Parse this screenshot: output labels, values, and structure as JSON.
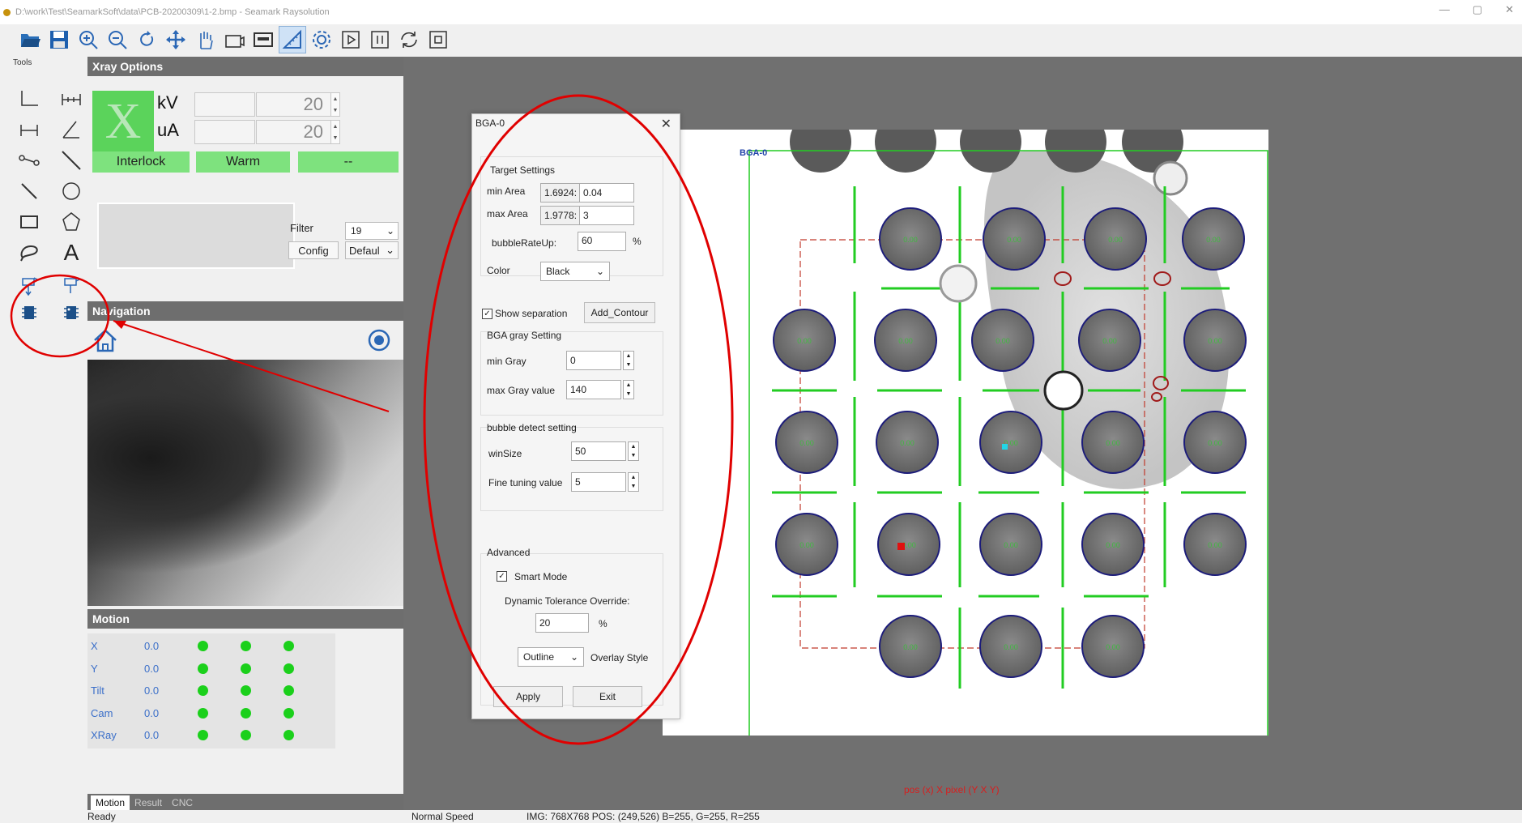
{
  "window": {
    "title": "D:\\work\\Test\\SeamarkSoft\\data\\PCB-20200309\\1-2.bmp - Seamark Raysolution",
    "controls": [
      "—",
      "▢",
      "✕"
    ]
  },
  "toolbar": {
    "icons": [
      "folder-open-icon",
      "save-icon",
      "zoom-in-icon",
      "zoom-out-icon",
      "rotate-icon",
      "move-icon",
      "hand-icon",
      "camera-icon",
      "image-icon",
      "measure-icon",
      "gear-icon",
      "play-icon",
      "pause-icon",
      "refresh-icon",
      "stop-icon"
    ]
  },
  "tools": {
    "label": "Tools",
    "text_tool": "A"
  },
  "xray": {
    "header": "Xray Options",
    "big_label": "X",
    "kv_label": "kV",
    "kv_value": "20",
    "ua_label": "uA",
    "ua_value": "20",
    "status_buttons": [
      "Interlock",
      "Warm",
      "--"
    ],
    "filter_label": "Filter",
    "filter_value": "19",
    "config_label": "Config",
    "default_value": "Defaul"
  },
  "navigation": {
    "header": "Navigation"
  },
  "motion": {
    "header": "Motion",
    "rows": [
      {
        "name": "X",
        "value": "0.0"
      },
      {
        "name": "Y",
        "value": "0.0"
      },
      {
        "name": "Tilt",
        "value": "0.0"
      },
      {
        "name": "Cam",
        "value": "0.0"
      },
      {
        "name": "XRay",
        "value": "0.0"
      }
    ]
  },
  "bottom_tabs": [
    "Motion",
    "Result",
    "CNC"
  ],
  "statusbar": {
    "ready": "Ready",
    "speed": "Normal Speed",
    "img_info": "IMG: 768X768  POS: (249,526) B=255, G=255, R=255"
  },
  "canvas": {
    "bga_label": "BGA-0",
    "ball_value": "0.00",
    "cursor_info": "pos (x) X pixel (Y X Y)"
  },
  "dialog": {
    "title": "BGA-0",
    "close": "✕",
    "target_settings": "Target Settings",
    "min_area_label": "min Area",
    "min_area_calc": "1.6924:",
    "min_area_value": "0.04",
    "max_area_label": "max Area",
    "max_area_calc": "1.9778:",
    "max_area_value": "3",
    "bubble_rate_label": "bubbleRateUp:",
    "bubble_rate_value": "60",
    "percent": "%",
    "color_label": "Color",
    "color_value": "Black",
    "show_separation": "Show separation",
    "add_contour": "Add_Contour",
    "bga_gray": "BGA gray Setting",
    "min_gray_label": "min Gray",
    "min_gray_value": "0",
    "max_gray_label": "max Gray value",
    "max_gray_value": "140",
    "bubble_detect": "bubble detect setting",
    "winsize_label": "winSize",
    "winsize_value": "50",
    "fine_label": "Fine tuning value",
    "fine_value": "5",
    "advanced": "Advanced",
    "smart_mode": "Smart Mode",
    "tolerance_label": "Dynamic Tolerance Override:",
    "tolerance_value": "20",
    "overlay_value": "Outline",
    "overlay_label": "Overlay Style",
    "apply": "Apply",
    "exit": "Exit"
  },
  "colors": {
    "panel_header": "#6e6e6e",
    "status_green": "#7ee27e",
    "annotation_red": "#e00000",
    "ball_outline": "#1c1c7a",
    "separator_green": "#22cc22"
  }
}
